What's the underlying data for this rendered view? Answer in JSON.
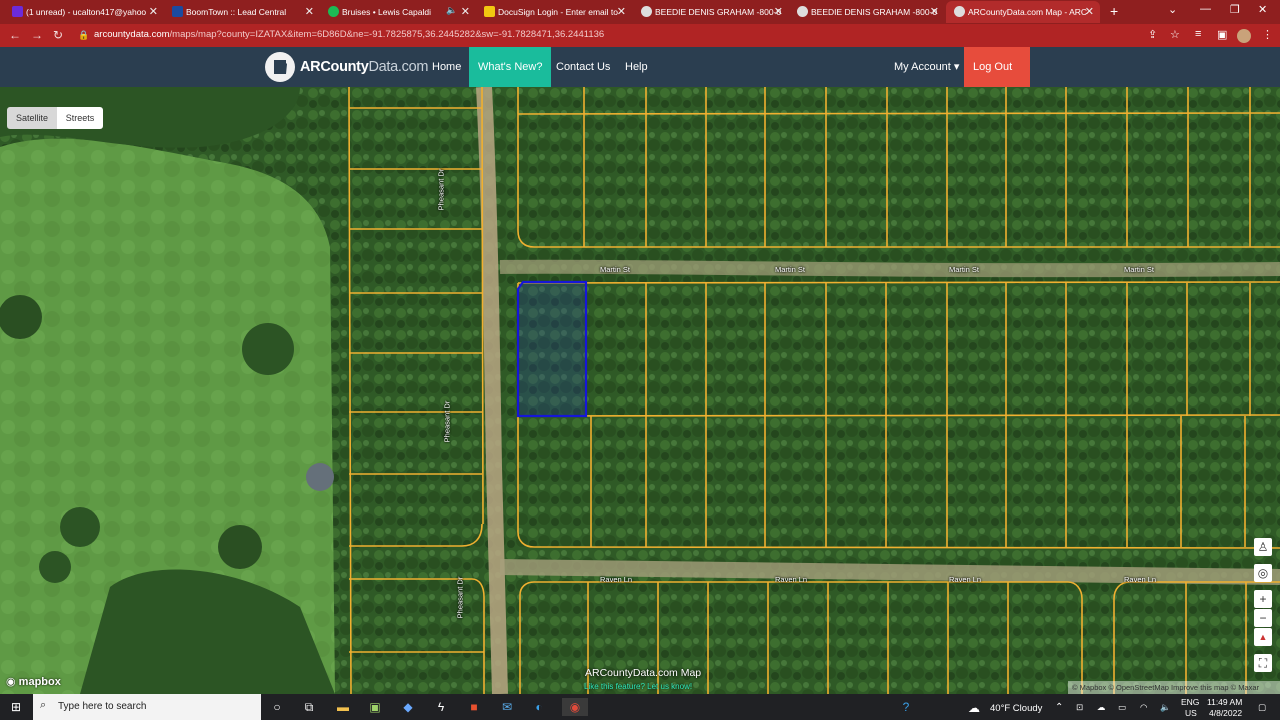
{
  "browser": {
    "tabs": [
      {
        "title": "(1 unread) - ucalton417@yahoo",
        "favicon_color": "#6c2bd9",
        "active": false
      },
      {
        "title": "BoomTown :: Lead Central",
        "favicon_color": "#1a4aa0",
        "active": false
      },
      {
        "title": "Bruises • Lewis Capaldi",
        "favicon_color": "#1db954",
        "active": false
      },
      {
        "title": "DocuSign Login - Enter email to",
        "favicon_color": "#f2c811",
        "active": false
      },
      {
        "title": "BEEDIE DENIS GRAHAM -800-0",
        "favicon_color": "#dddddd",
        "active": false
      },
      {
        "title": "BEEDIE DENIS GRAHAM -800-0",
        "favicon_color": "#dddddd",
        "active": false
      },
      {
        "title": "ARCountyData.com Map - ARC",
        "favicon_color": "#dddddd",
        "active": true
      }
    ],
    "new_tab": "+",
    "url_host": "arcountydata.com",
    "url_path": "/maps/map?county=IZATAX&item=6D86D&ne=-91.7825875,36.2445282&sw=-91.7828471,36.2441136"
  },
  "site": {
    "logo_main": "ARCounty",
    "logo_suffix": "Data.com",
    "nav": {
      "home": "Home",
      "whats_new": "What's New?",
      "contact": "Contact Us",
      "help": "Help",
      "my_account": "My Account ▾",
      "logout": "Log Out"
    },
    "colors": {
      "navbar": "#2b3e50",
      "whats_new": "#1abc9c",
      "logout": "#e74c3c",
      "parcel_lines": "#f0b030",
      "selected_parcel": "#1616d8"
    }
  },
  "map": {
    "layer_toggle": {
      "satellite": "Satellite",
      "streets": "Streets"
    },
    "streets": {
      "martin": "Martin St",
      "raven": "Raven Ln",
      "pheasant": "Pheasant Dr"
    },
    "controls": {
      "zoom_in": "+",
      "zoom_out": "−",
      "compass": "▲",
      "fullscreen": "⛶"
    },
    "brand": "mapbox",
    "feature_title": "ARCountyData.com Map",
    "feature_subtitle": "Like this feature? Let us know!",
    "attribution": "© Mapbox  © OpenStreetMap  Improve this map  © Maxar"
  },
  "taskbar": {
    "search_placeholder": "Type here to search",
    "weather": "40°F  Cloudy",
    "lang_top": "ENG",
    "lang_bottom": "US",
    "time": "11:49 AM",
    "date": "4/8/2022"
  }
}
